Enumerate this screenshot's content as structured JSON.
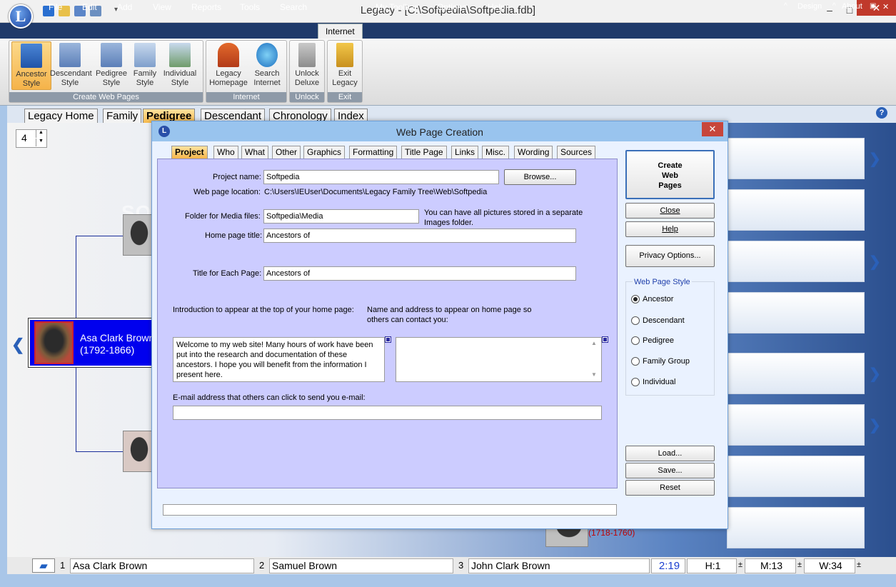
{
  "window": {
    "title": "Legacy - [C:\\Softpedia\\Softpedia.fdb]",
    "minimize": "–",
    "maximize": "□",
    "close": "✕"
  },
  "logo": {
    "letter": "L"
  },
  "menu": {
    "items": [
      "File",
      "Edit",
      "Add",
      "View",
      "Reports",
      "Tools",
      "Search",
      "Internet",
      "My Toolbar",
      "Options",
      "Help"
    ],
    "right": [
      "Design",
      "About"
    ],
    "active": "Internet"
  },
  "ribbon": {
    "groups": [
      {
        "label": "Create Web Pages",
        "buttons": [
          {
            "line1": "Ancestor",
            "line2": "Style",
            "icon": "ancestor-style-icon"
          },
          {
            "line1": "Descendant",
            "line2": "Style",
            "icon": "descendant-style-icon"
          },
          {
            "line1": "Pedigree",
            "line2": "Style",
            "icon": "pedigree-style-icon"
          },
          {
            "line1": "Family",
            "line2": "Style",
            "icon": "family-style-icon"
          },
          {
            "line1": "Individual",
            "line2": "Style",
            "icon": "individual-style-icon"
          }
        ]
      },
      {
        "label": "Internet",
        "buttons": [
          {
            "line1": "Legacy",
            "line2": "Homepage",
            "icon": "house-icon"
          },
          {
            "line1": "Search",
            "line2": "Internet",
            "icon": "globe-search-icon"
          }
        ]
      },
      {
        "label": "Unlock",
        "buttons": [
          {
            "line1": "Unlock",
            "line2": "Deluxe",
            "icon": "padlock-icon"
          }
        ]
      },
      {
        "label": "Exit",
        "buttons": [
          {
            "line1": "Exit",
            "line2": "Legacy",
            "icon": "exit-door-icon"
          }
        ]
      }
    ]
  },
  "main_tabs": [
    "Legacy Home",
    "Family",
    "Pedigree",
    "Descendant",
    "Chronology",
    "Index"
  ],
  "main_tab_active": "Pedigree",
  "generations": "4",
  "root_person": {
    "name": "Asa Clark Brown",
    "dates": "(1792-1866)"
  },
  "bottom_person": {
    "dates": "(1718-1760)"
  },
  "watermark": "SOFTPEDIA",
  "statusbar": {
    "items": [
      {
        "num": "1",
        "name": "Asa Clark Brown"
      },
      {
        "num": "2",
        "name": "Samuel Brown"
      },
      {
        "num": "3",
        "name": "John Clark Brown"
      }
    ],
    "time": "2:19",
    "h": "H:1",
    "m": "M:13",
    "w": "W:34",
    "pm": "±"
  },
  "dialog": {
    "title": "Web Page Creation",
    "logo": "L",
    "tabs": [
      "Project",
      "Who",
      "What",
      "Other",
      "Graphics",
      "Formatting",
      "Title Page",
      "Links",
      "Misc.",
      "Wording",
      "Sources"
    ],
    "active_tab": "Project",
    "project_name_label": "Project name:",
    "project_name": "Softpedia",
    "browse": "Browse...",
    "location_label": "Web page location:",
    "location": "C:\\Users\\IEUser\\Documents\\Legacy Family Tree\\Web\\Softpedia",
    "media_label": "Folder for Media files:",
    "media": "Softpedia\\Media",
    "media_note1": "You can have all pictures stored in a separate",
    "media_note2": "Images folder.",
    "home_title_label": "Home page title:",
    "home_title": "Ancestors of",
    "each_title_label": "Title for Each Page:",
    "each_title": "Ancestors of",
    "intro_label": "Introduction to appear at the top of your home page:",
    "intro_text": "Welcome to my web site!  Many hours of work have been put into the research and documentation of these ancestors. I hope you will benefit from the information I present here.",
    "address_label1": "Name and address to appear on home page so",
    "address_label2": "others can contact you:",
    "address_text": "",
    "email_label": "E-mail address that others can click to send you e-mail:",
    "email": "",
    "buttons": {
      "create1": "Create",
      "create2": "Web",
      "create3": "Pages",
      "close": "Close",
      "help": "Help",
      "privacy": "Privacy Options...",
      "load": "Load...",
      "save": "Save...",
      "reset": "Reset"
    },
    "style_group_label": "Web Page Style",
    "styles": [
      "Ancestor",
      "Descendant",
      "Pedigree",
      "Family Group",
      "Individual"
    ],
    "style_selected": "Ancestor",
    "accent": "#ccccff"
  }
}
